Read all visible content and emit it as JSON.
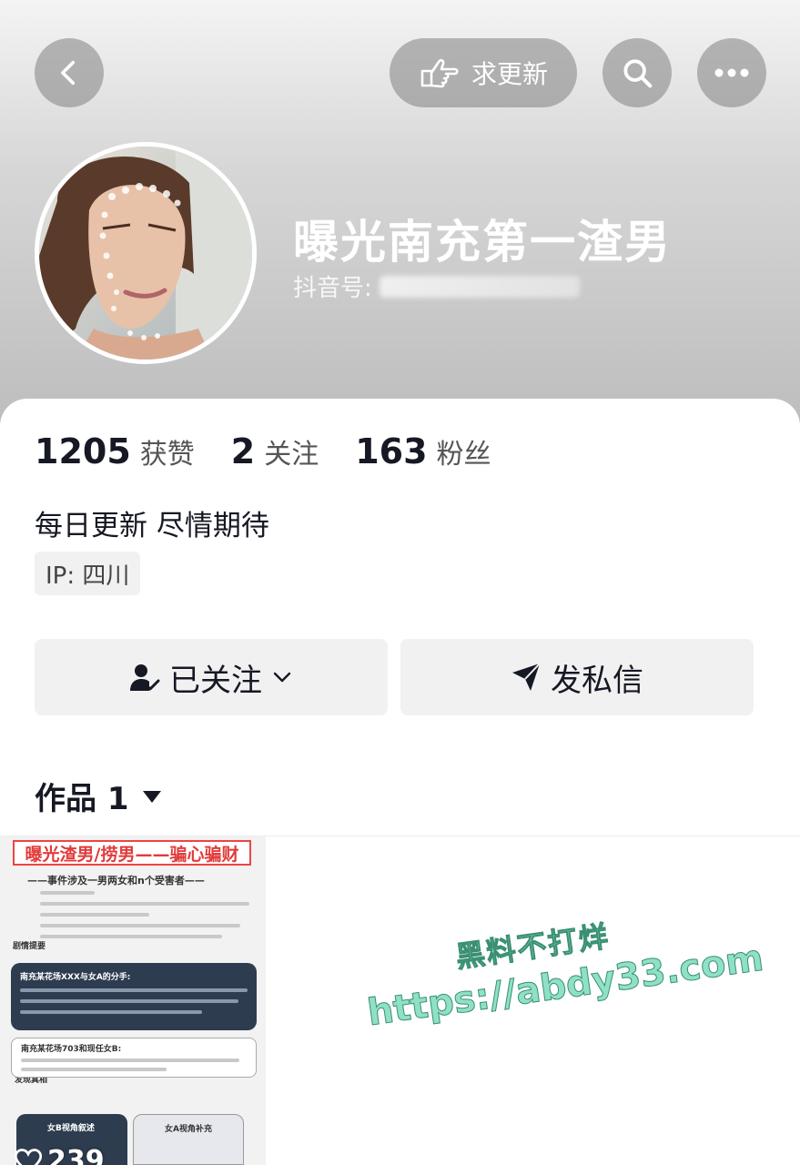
{
  "header": {
    "update_button_label": "求更新",
    "nickname": "曝光南充第一渣男",
    "douyin_id_prefix": "抖音号:"
  },
  "stats": {
    "likes_count": "1205",
    "likes_label": "获赞",
    "following_count": "2",
    "following_label": "关注",
    "followers_count": "163",
    "followers_label": "粉丝"
  },
  "bio": "每日更新 尽情期待",
  "ip_tag": "IP:  四川",
  "actions": {
    "following_label": "已关注",
    "message_label": "发私信"
  },
  "works_tab": {
    "label": "作品 1"
  },
  "thumbnail": {
    "title": "曝光渣男/捞男——骗心骗财",
    "subtitle": "——事件涉及一男两女和n个受害者——",
    "section_1": "剧情提要",
    "box_1_title": "南充某花场XXX与女A的分手:",
    "box_2_title": "南充某花场703和现任女B:",
    "section_2": "发现真相",
    "box_3_title": "女B视角叙述",
    "box_4_title": "女A视角补充",
    "like_count": "239"
  },
  "watermark": {
    "line1": "黑料不打烊",
    "line2": "https://abdy33.com"
  },
  "colors": {
    "text_primary": "#161823",
    "button_bg": "#f1f1f2",
    "watermark": "#8ee0c6",
    "thumb_title_red": "#e23b3b"
  }
}
